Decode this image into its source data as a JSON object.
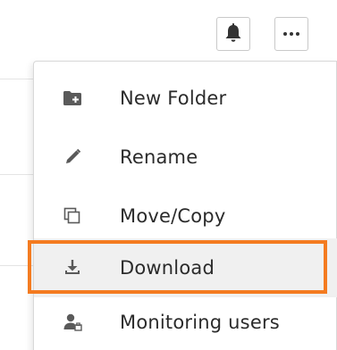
{
  "header": {
    "notifications_icon": "bell-icon",
    "more_icon": "more-horizontal-icon"
  },
  "menu": {
    "items": [
      {
        "label": "New Folder",
        "icon": "new-folder-icon"
      },
      {
        "label": "Rename",
        "icon": "pencil-icon"
      },
      {
        "label": "Move/Copy",
        "icon": "copy-icon"
      },
      {
        "label": "Download",
        "icon": "download-icon",
        "highlighted": true
      },
      {
        "label": "Monitoring users",
        "icon": "monitoring-users-icon"
      }
    ]
  },
  "colors": {
    "highlight_border": "#f47b20",
    "icon": "#555555",
    "text": "#2b2b2b"
  }
}
